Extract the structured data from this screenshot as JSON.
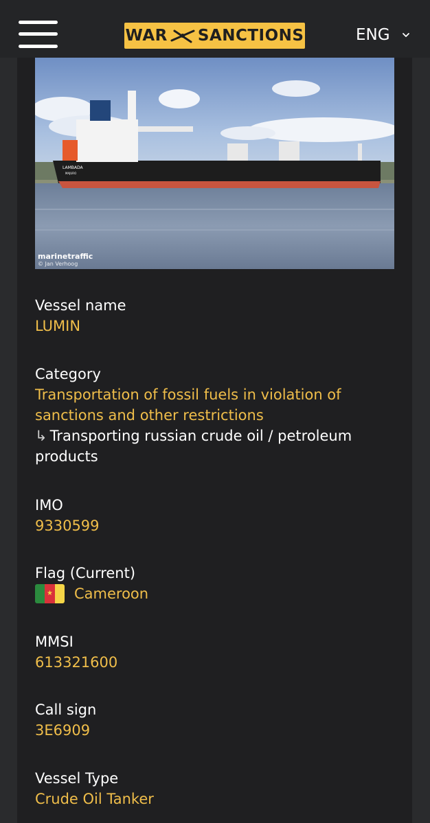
{
  "header": {
    "logo_left": "WAR",
    "logo_right": "SANCTIONS",
    "language": "ENG"
  },
  "photo": {
    "hull_name": "LAMBADA",
    "hull_port": "MAJURO",
    "credit_brand": "marinetraffic",
    "credit_author": "© Jan Verhoog"
  },
  "fields": {
    "vessel_name": {
      "label": "Vessel name",
      "value": "LUMIN"
    },
    "category": {
      "label": "Category",
      "value": "Transportation of fossil fuels in violation of sanctions and other restrictions",
      "sub_arrow": "↳",
      "sub_value": "Transporting russian crude oil / petroleum products"
    },
    "imo": {
      "label": "IMO",
      "value": "9330599"
    },
    "flag": {
      "label": "Flag (Current)",
      "value": "Cameroon"
    },
    "mmsi": {
      "label": "MMSI",
      "value": "613321600"
    },
    "call_sign": {
      "label": "Call sign",
      "value": "3E6909"
    },
    "vessel_type": {
      "label": "Vessel Type",
      "value": "Crude Oil Tanker"
    }
  },
  "colors": {
    "accent": "#f0be4a",
    "logo_bg": "#f6c244",
    "background": "#1f1f21"
  }
}
